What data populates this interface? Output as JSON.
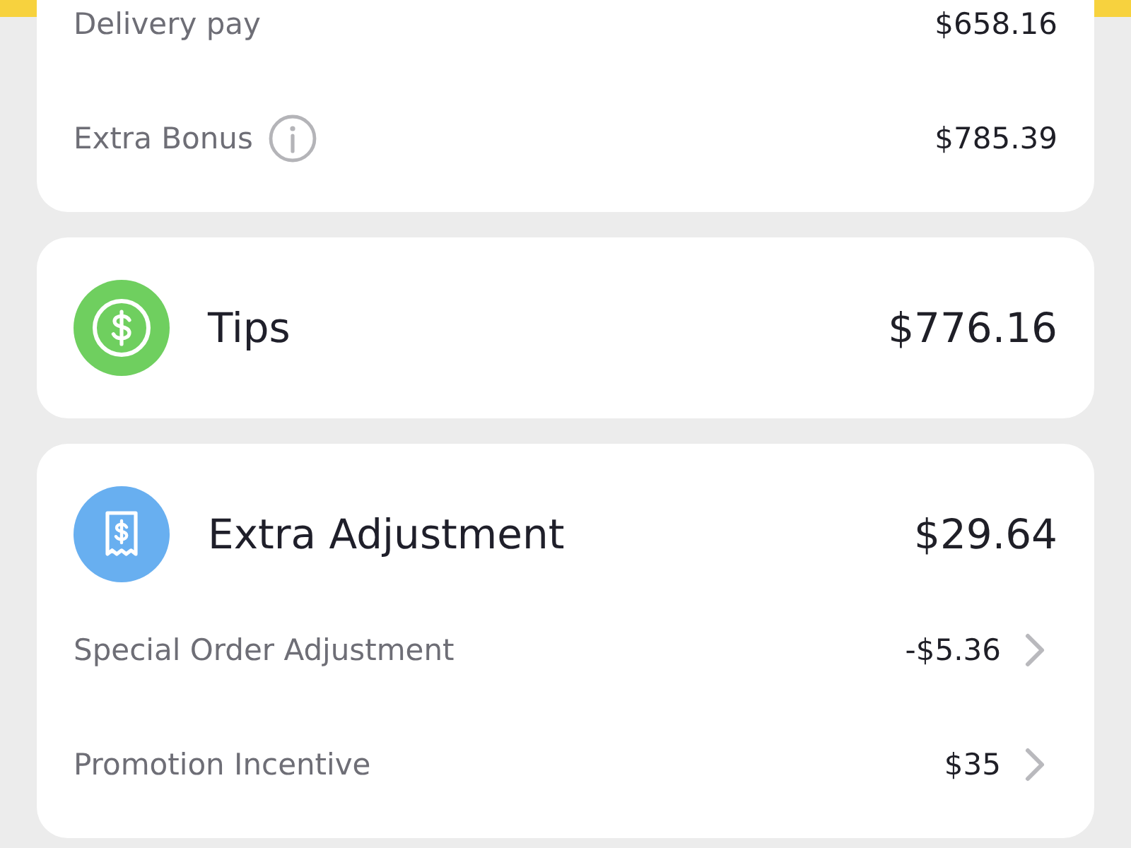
{
  "earnings": {
    "rows": [
      {
        "label": "Delivery pay",
        "amount": "$658.16",
        "info": false
      },
      {
        "label": "Extra Bonus",
        "amount": "$785.39",
        "info": true
      }
    ]
  },
  "tips": {
    "title": "Tips",
    "amount": "$776.16"
  },
  "extra_adjustment": {
    "title": "Extra Adjustment",
    "amount": "$29.64",
    "rows": [
      {
        "label": "Special Order Adjustment",
        "amount": "-$5.36"
      },
      {
        "label": "Promotion Incentive",
        "amount": "$35"
      }
    ]
  }
}
